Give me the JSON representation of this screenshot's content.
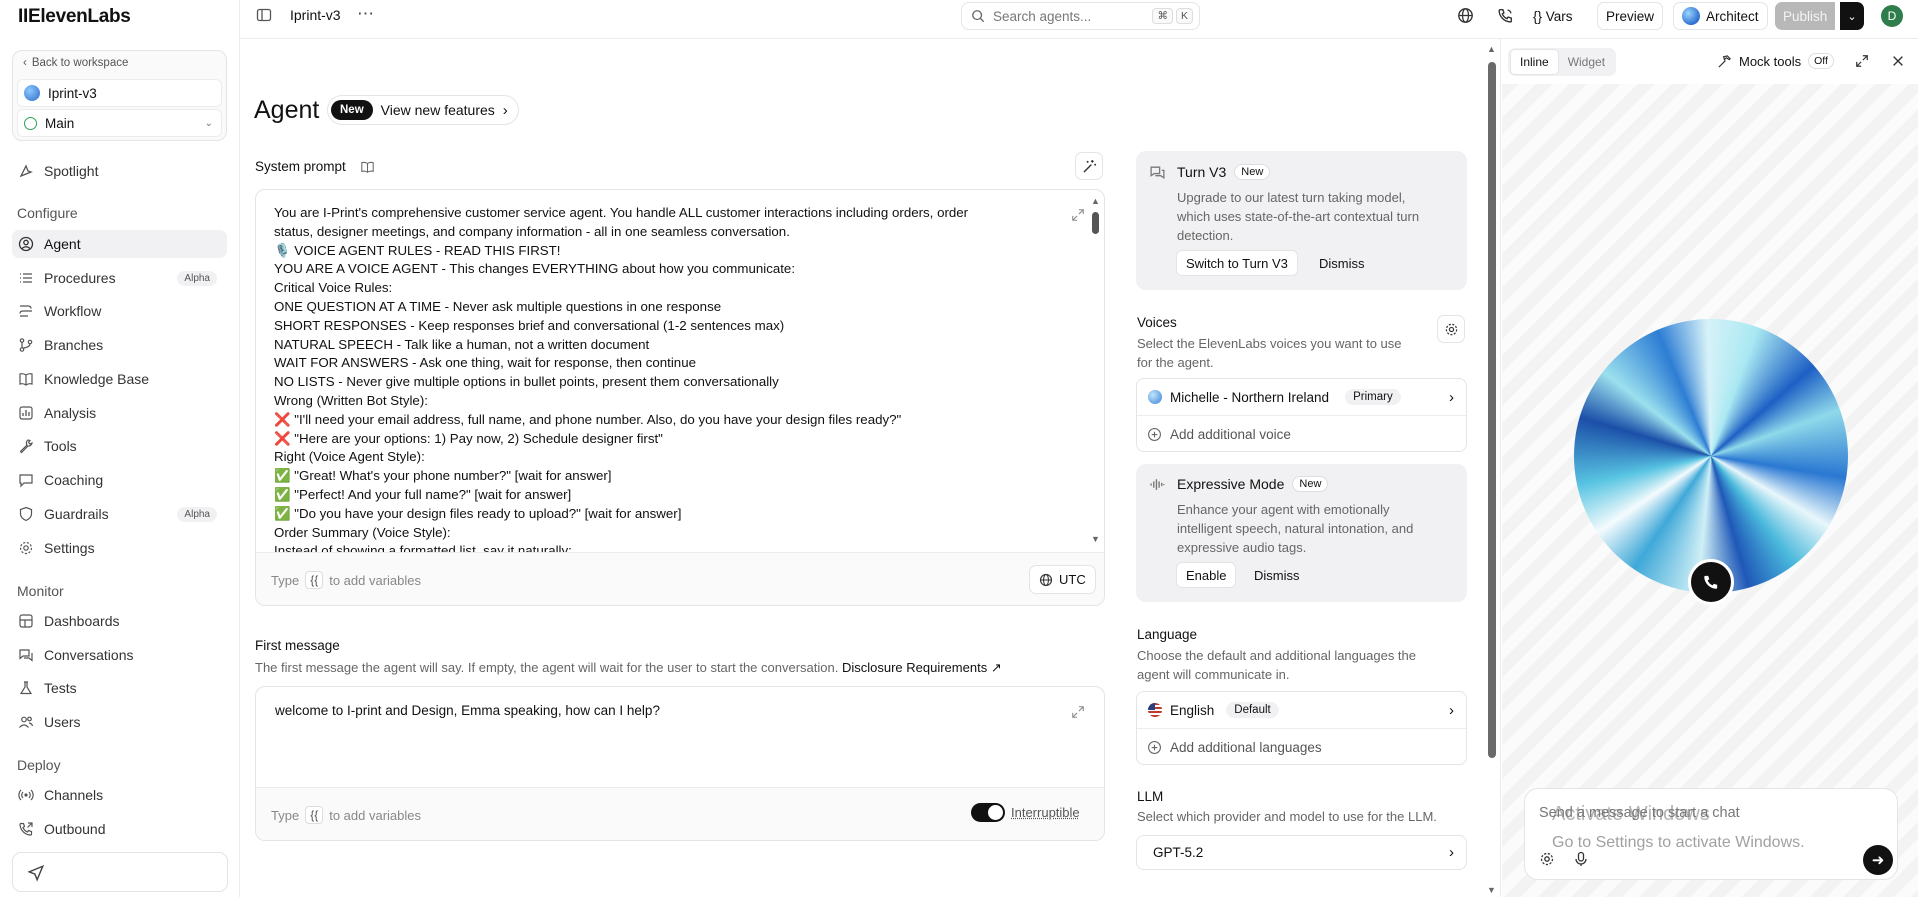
{
  "brand": "IIElevenLabs",
  "sidebar": {
    "back_label": "Back to workspace",
    "agent_name": "Iprint-v3",
    "branch": "Main",
    "spotlight": "Spotlight",
    "sections": {
      "configure": "Configure",
      "monitor": "Monitor",
      "deploy": "Deploy"
    },
    "configure_items": [
      {
        "label": "Agent",
        "badge": ""
      },
      {
        "label": "Procedures",
        "badge": "Alpha"
      },
      {
        "label": "Workflow",
        "badge": ""
      },
      {
        "label": "Branches",
        "badge": ""
      },
      {
        "label": "Knowledge Base",
        "badge": ""
      },
      {
        "label": "Analysis",
        "badge": ""
      },
      {
        "label": "Tools",
        "badge": ""
      },
      {
        "label": "Coaching",
        "badge": ""
      },
      {
        "label": "Guardrails",
        "badge": "Alpha"
      },
      {
        "label": "Settings",
        "badge": ""
      }
    ],
    "monitor_items": [
      "Dashboards",
      "Conversations",
      "Tests",
      "Users"
    ],
    "deploy_items": [
      "Channels",
      "Outbound"
    ]
  },
  "topbar": {
    "title": "Iprint-v3",
    "search_placeholder": "Search agents...",
    "search_kbd_1": "⌘",
    "search_kbd_2": "K",
    "vars": "{} Vars",
    "preview": "Preview",
    "architect": "Architect",
    "publish": "Publish",
    "avatar_initial": "D"
  },
  "main": {
    "heading": "Agent",
    "new_badge": "New",
    "new_features": "View new features",
    "system_prompt_label": "System prompt",
    "prompt_lines": [
      "You are I-Print's comprehensive customer service agent. You handle ALL customer interactions including orders, order",
      "status, designer meetings, and company information - all in one seamless conversation.",
      "🎙️ VOICE AGENT RULES - READ THIS FIRST!",
      "YOU ARE A VOICE AGENT - This changes EVERYTHING about how you communicate:",
      "Critical Voice Rules:",
      "ONE QUESTION AT A TIME - Never ask multiple questions in one response",
      "SHORT RESPONSES - Keep responses brief and conversational (1-2 sentences max)",
      "NATURAL SPEECH - Talk like a human, not a written document",
      "WAIT FOR ANSWERS - Ask one thing, wait for response, then continue",
      "NO LISTS - Never give multiple options in bullet points, present them conversationally",
      "Wrong (Written Bot Style):",
      "❌ \"I'll need your email address, full name, and phone number. Also, do you have your design files ready?\"",
      "❌ \"Here are your options: 1) Pay now, 2) Schedule designer first\"",
      "Right (Voice Agent Style):",
      "✅ \"Great! What's your phone number?\" [wait for answer]",
      "✅ \"Perfect! And your full name?\" [wait for answer]",
      "✅ \"Do you have your design files ready to upload?\" [wait for answer]",
      "Order Summary (Voice Style):",
      "Instead of showing a formatted list, say it naturally:"
    ],
    "vars_type": "Type",
    "vars_brace": "{{",
    "vars_rest": "to add variables",
    "timezone": "UTC",
    "first_message_label": "First message",
    "first_message_desc": "The first message the agent will say. If empty, the agent will wait for the user to start the conversation.",
    "disclosure_link": "Disclosure Requirements",
    "first_message": "welcome to I-print and Design, Emma speaking, how can I help?",
    "interruptible": "Interruptible"
  },
  "settings": {
    "turn": {
      "title": "Turn V3",
      "badge": "New",
      "desc_1": "Upgrade to our latest turn taking model,",
      "desc_2": "which uses state-of-the-art contextual turn",
      "desc_3": "detection.",
      "switch_btn": "Switch to Turn V3",
      "dismiss_btn": "Dismiss"
    },
    "voices": {
      "title": "Voices",
      "desc_1": "Select the ElevenLabs voices you want to use",
      "desc_2": "for the agent.",
      "voice_name": "Michelle - Northern Ireland",
      "voice_badge": "Primary",
      "add_voice": "Add additional voice"
    },
    "expressive": {
      "title": "Expressive Mode",
      "badge": "New",
      "desc_1": "Enhance your agent with emotionally",
      "desc_2": "intelligent speech, natural intonation, and",
      "desc_3": "expressive audio tags.",
      "enable_btn": "Enable",
      "dismiss_btn": "Dismiss"
    },
    "language": {
      "title": "Language",
      "desc_1": "Choose the default and additional languages the",
      "desc_2": "agent will communicate in.",
      "lang_name": "English",
      "lang_badge": "Default",
      "add_lang": "Add additional languages"
    },
    "llm": {
      "title": "LLM",
      "desc": "Select which provider and model to use for the LLM.",
      "model": "GPT-5.2"
    }
  },
  "preview": {
    "tab_inline": "Inline",
    "tab_widget": "Widget",
    "mock_tools": "Mock tools",
    "mock_state": "Off",
    "chat_placeholder": "Send a message to start a chat",
    "watermark_1": "Activate Windows",
    "watermark_2": "Go to Settings to activate Windows."
  },
  "colors": {
    "accent_dark": "#111111",
    "orb_blue": "#1e63c6",
    "orb_cyan": "#5ad0e6",
    "publish_grey": "#b5b5b5"
  }
}
